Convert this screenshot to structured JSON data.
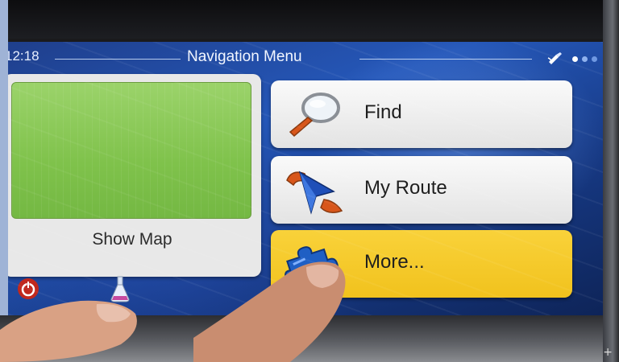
{
  "status_bar": {
    "clock": "12:18",
    "title": "Navigation Menu"
  },
  "tiles": {
    "show_map_label": "Show Map",
    "find_label": "Find",
    "my_route_label": "My Route",
    "more_label": "More..."
  },
  "icons": {
    "find": "magnifier-icon",
    "my_route": "route-arrow-icon",
    "more": "puzzle-icon",
    "gps": "gps-satellite-icon",
    "power": "power-icon",
    "bottom_middle": "flask-icon"
  },
  "colors": {
    "screen_blue": "#2557b8",
    "more_button": "#f1c21d",
    "map_green": "#7fc24b",
    "button_light": "#e3e3e3"
  }
}
